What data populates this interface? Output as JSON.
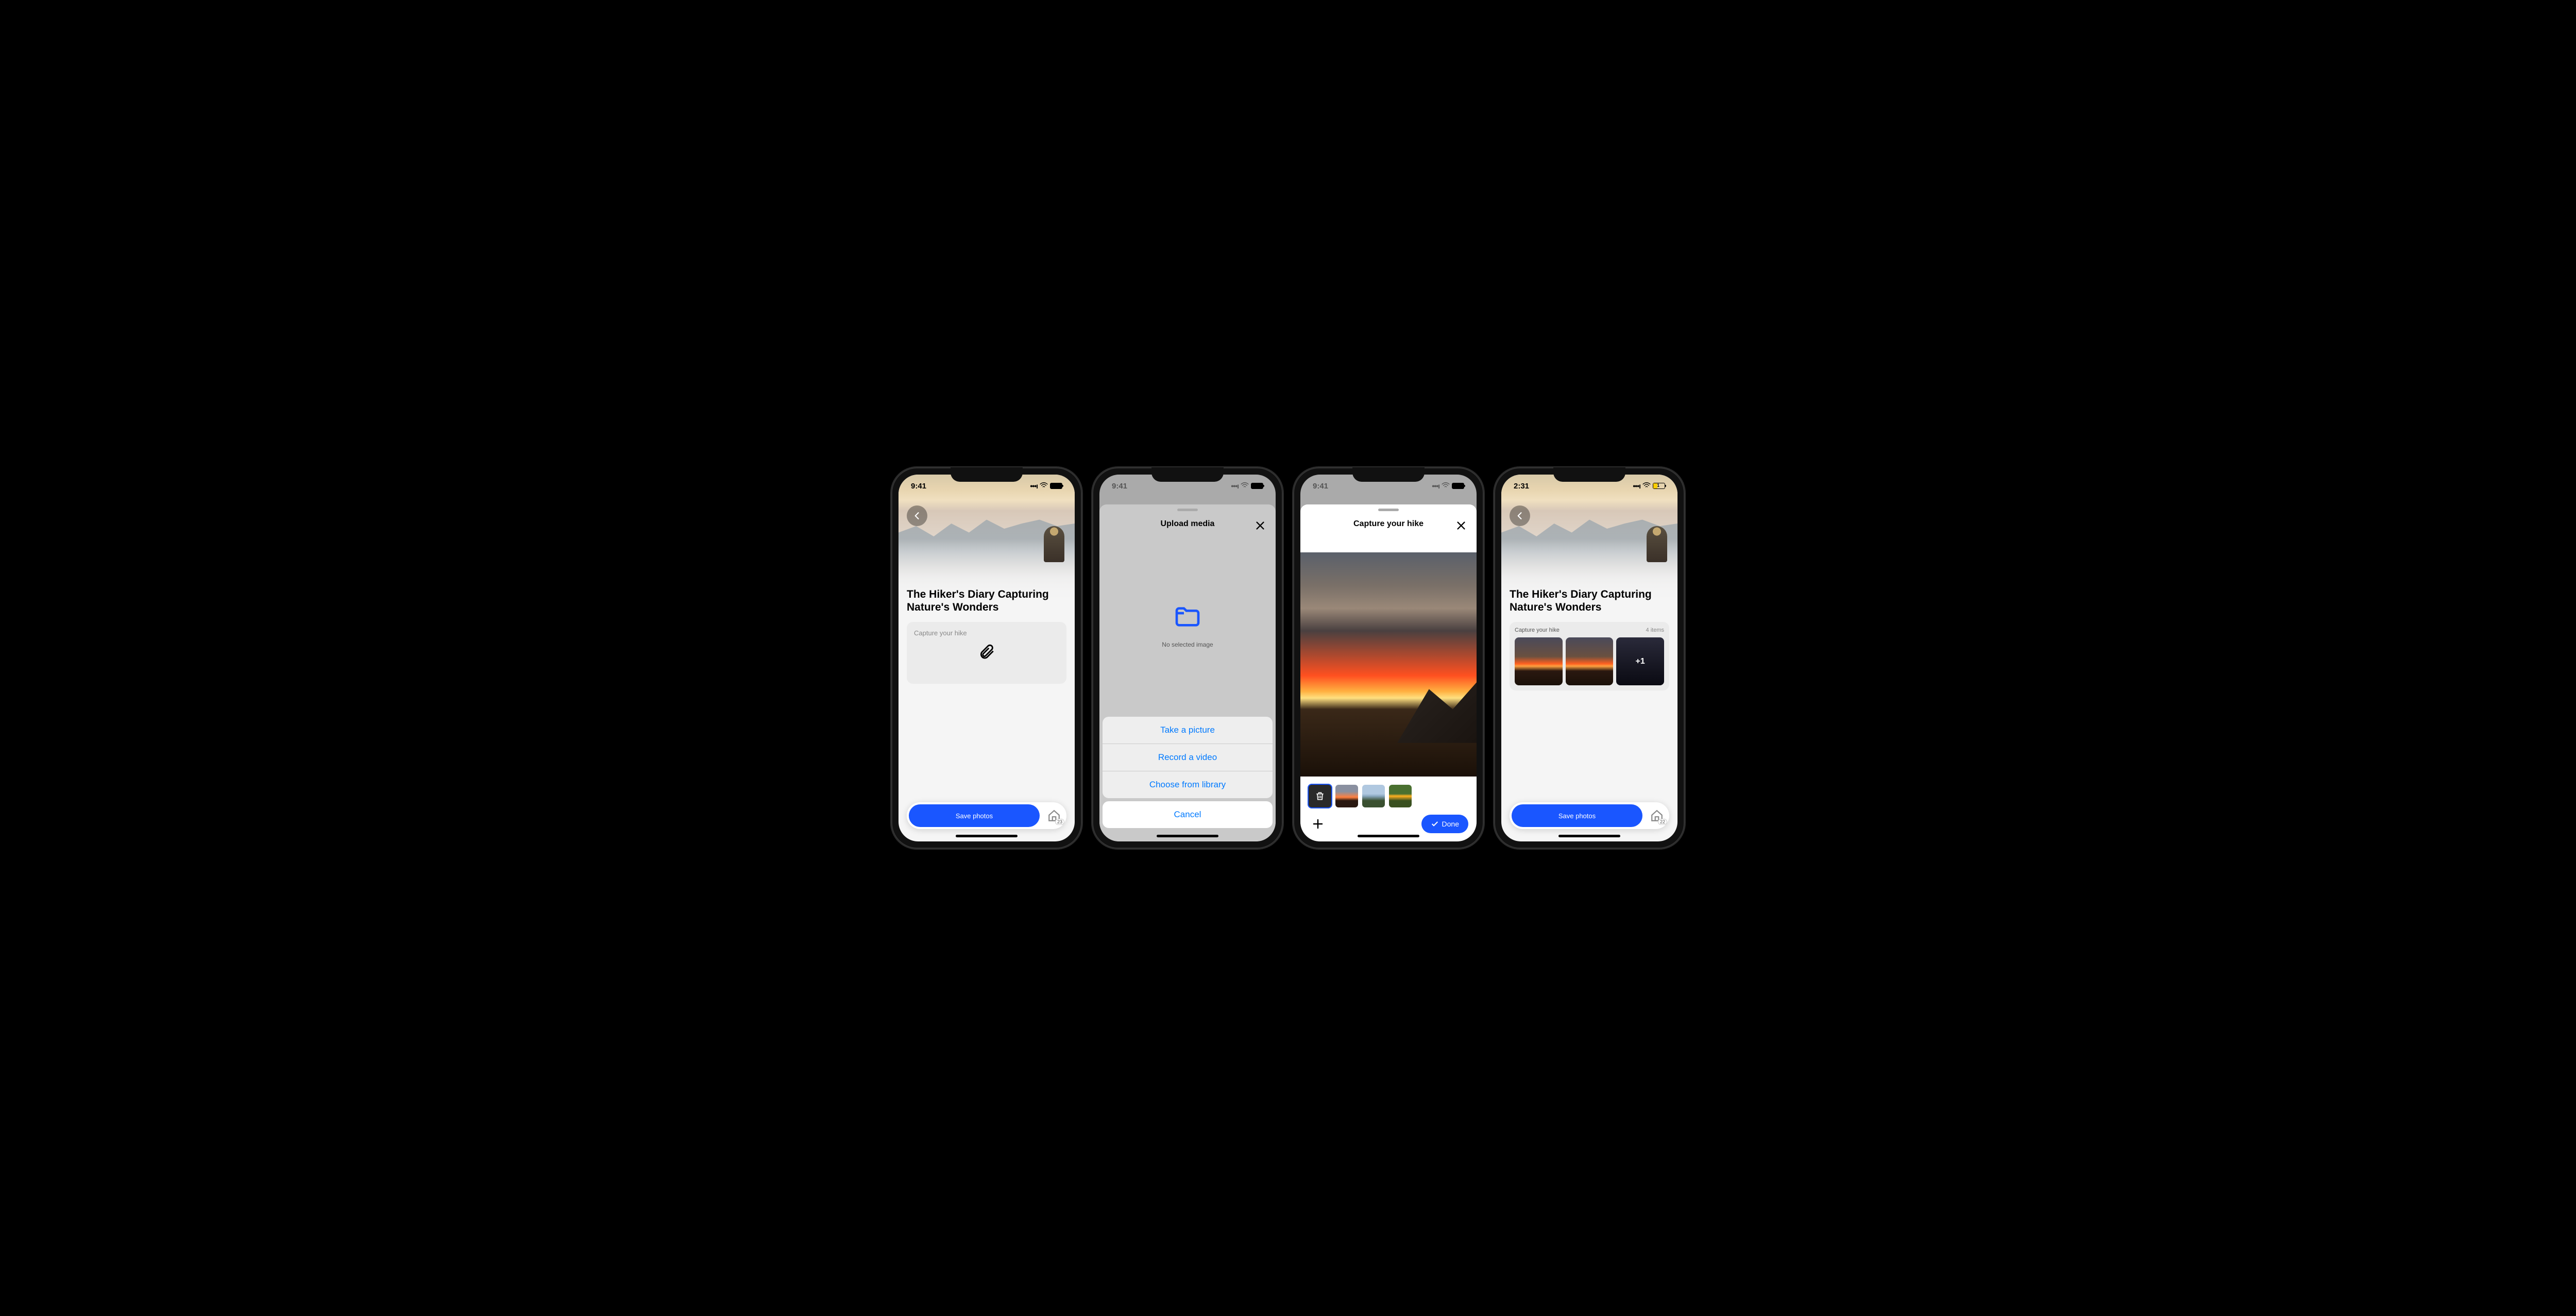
{
  "screens": [
    {
      "status": {
        "time": "9:41",
        "battery_pct": 100
      },
      "back": true,
      "title": "The Hiker's Diary Capturing Nature's Wonders",
      "upload": {
        "label": "Capture your hike"
      },
      "cta": {
        "label": "Save photos"
      },
      "home_badge": "23"
    },
    {
      "status": {
        "time": "9:41"
      },
      "sheet": {
        "title": "Upload media",
        "empty_text": "No selected image",
        "actions": {
          "take_picture": "Take a picture",
          "record_video": "Record a video",
          "choose_library": "Choose from library",
          "cancel": "Cancel"
        }
      }
    },
    {
      "status": {
        "time": "9:41"
      },
      "sheet": {
        "title": "Capture your hike",
        "done": "Done",
        "thumb_count": 4,
        "selected_index": 0
      }
    },
    {
      "status": {
        "time": "2:31",
        "battery_pct": 31,
        "low": true
      },
      "back": true,
      "title": "The Hiker's Diary Capturing Nature's Wonders",
      "gallery": {
        "label": "Capture your hike",
        "count_text": "4 items",
        "overflow": "+1"
      },
      "cta": {
        "label": "Save photos"
      },
      "home_badge": "22"
    }
  ]
}
